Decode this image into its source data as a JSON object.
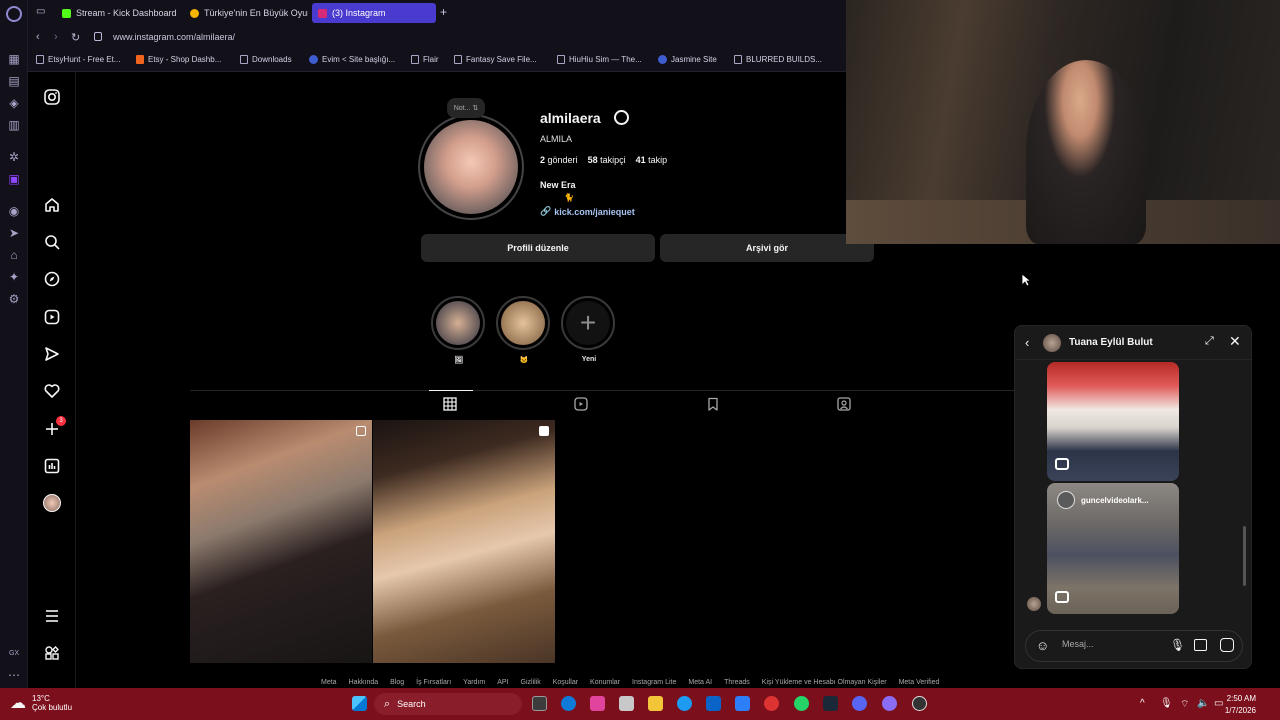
{
  "browser": {
    "tabs": [
      {
        "label": "Stream - Kick Dashboard",
        "color": "#53fc18"
      },
      {
        "label": "Türkiye'nin En Büyük Oyun",
        "color": "#f5b400"
      },
      {
        "label": "(3) Instagram",
        "color": "#d62976"
      }
    ],
    "url": "www.instagram.com/almilaera/",
    "bookmarks": [
      "EtsyHunt - Free Et...",
      "Etsy - Shop Dashb...",
      "Downloads",
      "Evim < Site başlığı...",
      "Flair",
      "Fantasy Save File...",
      "HiuHiu Sim — The...",
      "Jasmine Site",
      "BLURRED BUILDS..."
    ]
  },
  "instagram": {
    "nav_badge": "3",
    "profile": {
      "note": "Not...",
      "username": "almilaera",
      "full_name": "ALMILA",
      "posts_count": "2",
      "posts_label": "gönderi",
      "followers_count": "58",
      "followers_label": "takipçi",
      "following_count": "41",
      "following_label": "takip",
      "bio": "New Era",
      "bio_emoji": "🐈",
      "link": "kick.com/janiequet",
      "edit_button": "Profili düzenle",
      "archive_button": "Arşivi gör"
    },
    "highlights": [
      {
        "label": "🖼"
      },
      {
        "label": "🐱"
      },
      {
        "label": "Yeni"
      }
    ],
    "footer_links": [
      "Meta",
      "Hakkında",
      "Blog",
      "İş Fırsatları",
      "Yardım",
      "API",
      "Gizlilik",
      "Koşullar",
      "Konumlar",
      "Instagram Lite",
      "Meta AI",
      "Threads",
      "Kişi Yükleme ve Hesabı Olmayan Kişiler",
      "Meta Verified"
    ]
  },
  "dm": {
    "contact_name": "Tuana Eylül Bulut",
    "reel_caption": "guncelvideolark...",
    "input_placeholder": "Mesaj..."
  },
  "taskbar": {
    "temperature": "13°C",
    "weather": "Çok bulutlu",
    "search_label": "Search",
    "time": "2:50 AM",
    "date": "1/7/2026"
  },
  "colors": {
    "accent": "#4a3bd0",
    "taskbar": "#7b0f1c",
    "instagram_bg": "#000000"
  }
}
